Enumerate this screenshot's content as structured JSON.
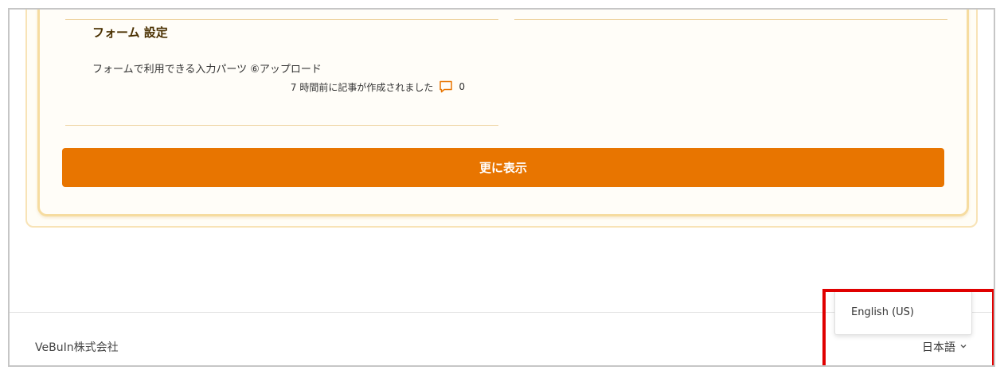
{
  "section": {
    "title": "フォーム 設定",
    "article_title": "フォームで利用できる入力パーツ ⑥アップロード",
    "meta_text": "7 時間前に記事が作成されました",
    "comment_count": "0"
  },
  "more_button": {
    "label": "更に表示"
  },
  "footer": {
    "company": "VeBuIn株式会社",
    "language_current": "日本語",
    "language_options": [
      "English (US)"
    ]
  },
  "colors": {
    "accent": "#e87500",
    "card_border": "#f6dca0",
    "highlight": "#e00000"
  },
  "icons": [
    "comment-icon",
    "chevron-down-icon"
  ]
}
